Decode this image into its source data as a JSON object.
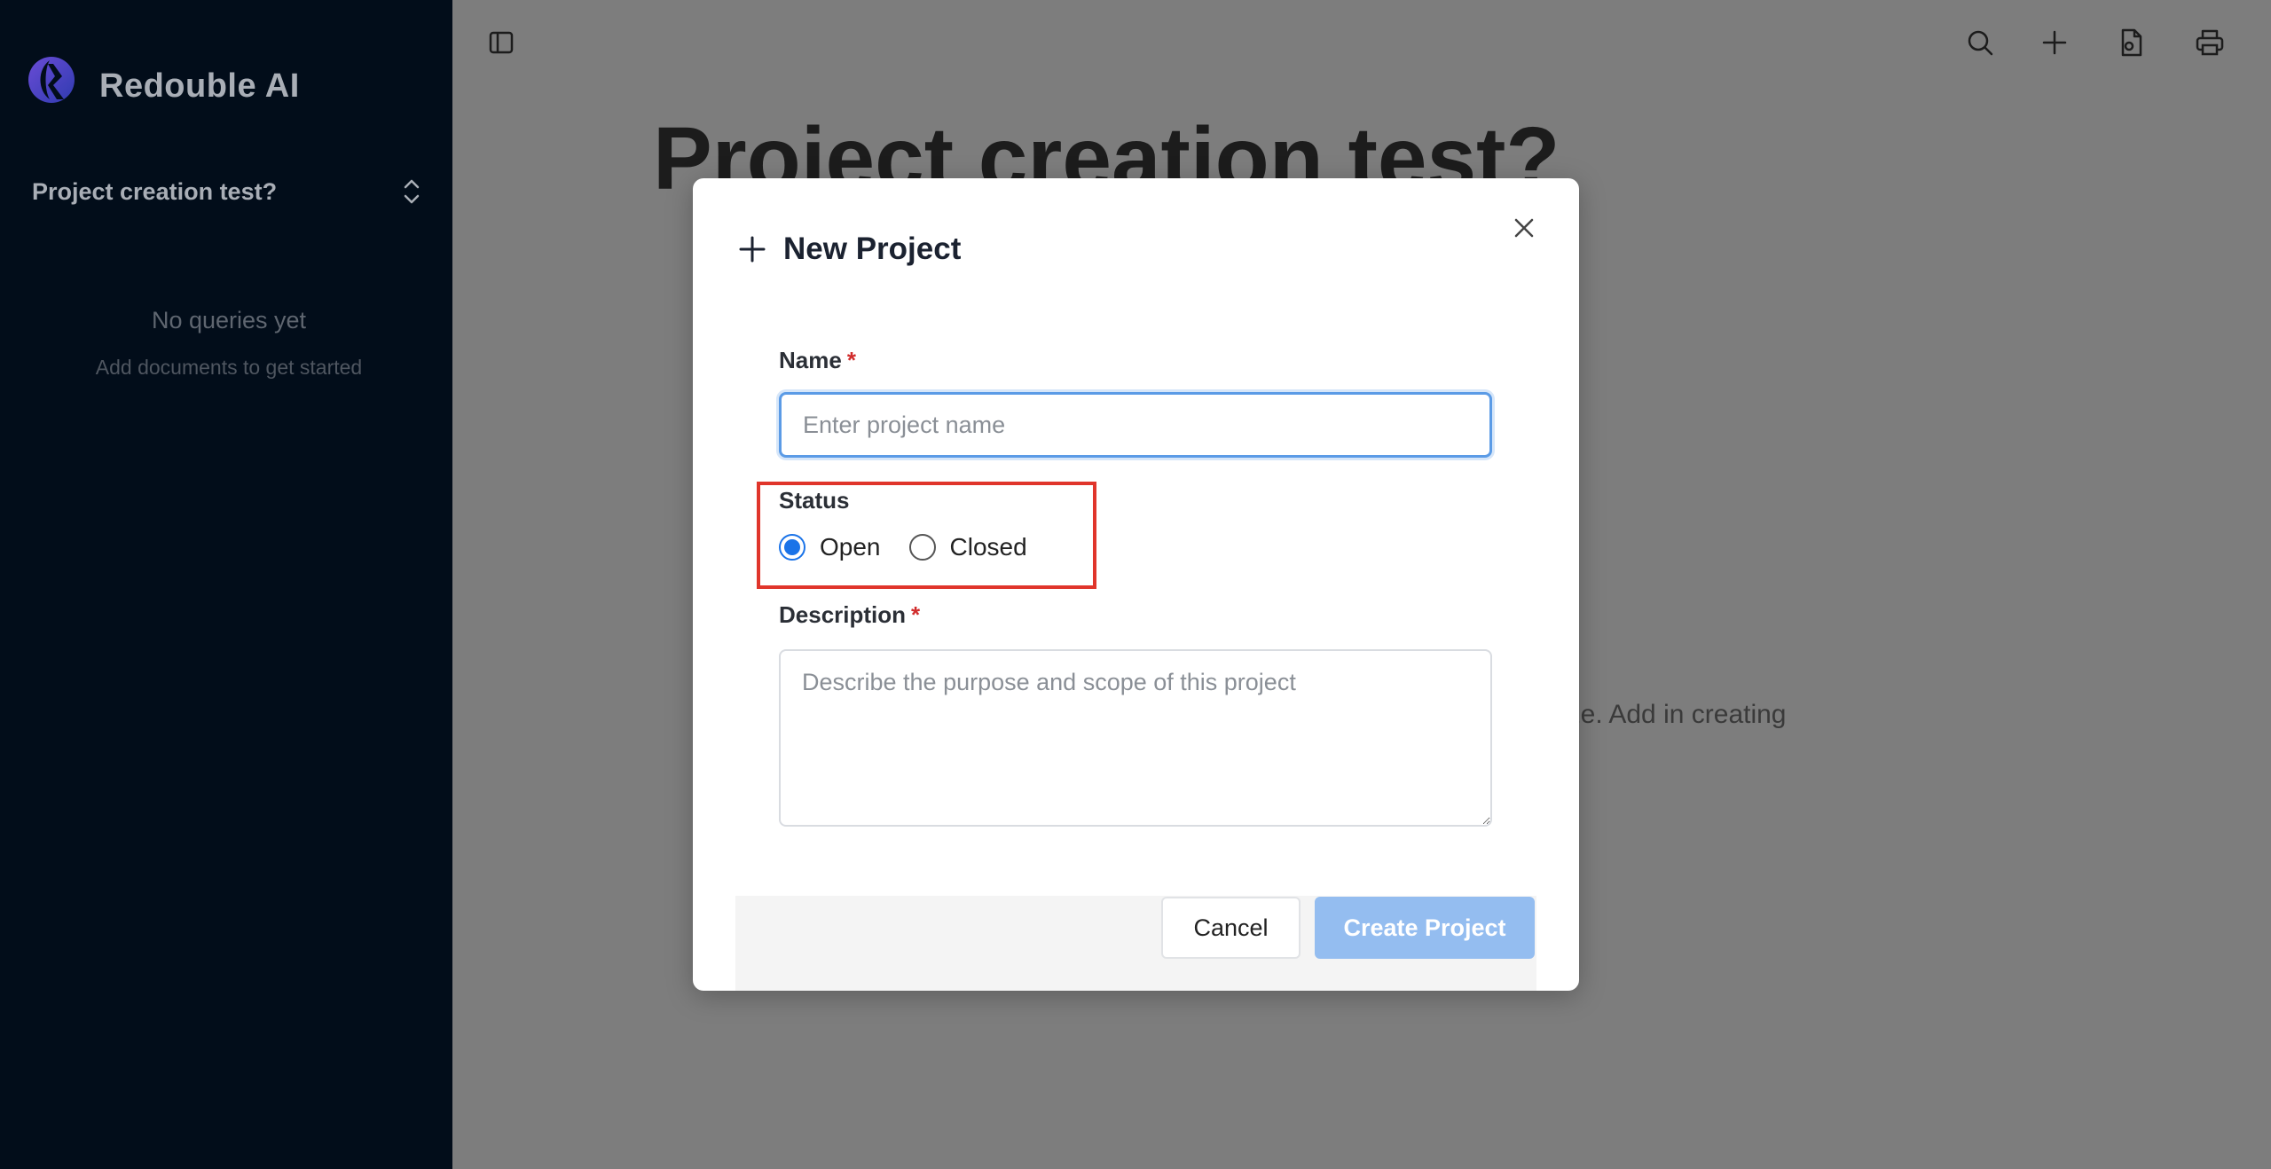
{
  "app": {
    "brand_name": "Redouble AI"
  },
  "sidebar": {
    "project_name": "Project creation test?",
    "empty_title": "No queries yet",
    "empty_subtitle": "Add documents to get started"
  },
  "page": {
    "title": "Project creation test?",
    "paragraph_fragment": "lyze. Add in creating"
  },
  "topbar": {
    "icons": [
      "search-icon",
      "plus-icon",
      "file-export-icon",
      "printer-icon"
    ]
  },
  "modal": {
    "title": "New Project",
    "name_label": "Name",
    "required_marker": "*",
    "name_placeholder": "Enter project name",
    "name_value": "",
    "status_label": "Status",
    "status_options": [
      "Open",
      "Closed"
    ],
    "status_selected": "Open",
    "description_label": "Description",
    "description_placeholder": "Describe the purpose and scope of this project",
    "cancel_label": "Cancel",
    "create_label": "Create Project"
  },
  "colors": {
    "sidebar_bg": "#020d1a",
    "overlay_bg": "#7d7d7d",
    "accent": "#1a73e8",
    "create_button_disabled": "#94bdf0",
    "highlight": "#e0352b"
  }
}
